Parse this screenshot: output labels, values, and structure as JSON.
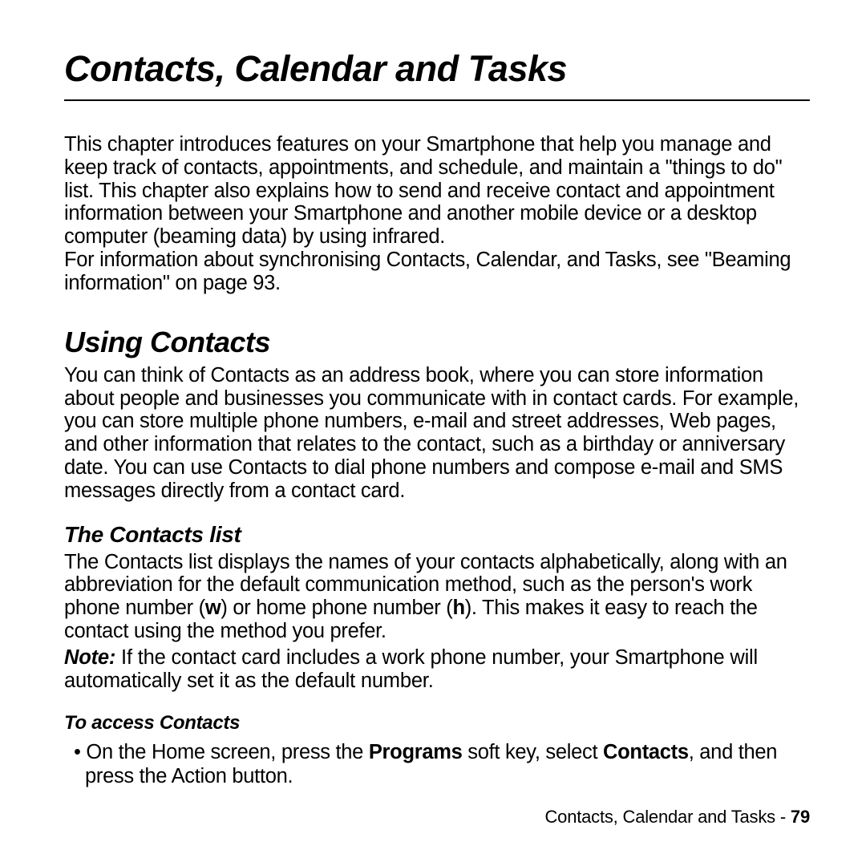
{
  "chapter_title": "Contacts, Calendar and Tasks",
  "intro_para": "This chapter introduces features on your Smartphone that help you manage and keep track of contacts, appointments, and schedule, and maintain a \"things to do\" list. This chapter also explains how to send and receive contact and appointment information between your Smartphone and another mobile device or a desktop computer (beaming data) by using infrared.",
  "intro_para2": "For information about synchronising Contacts, Calendar, and Tasks, see \"Beaming information\" on page 93.",
  "section_title": "Using Contacts",
  "section_para": "You can think of Contacts as an address book, where you can store information about people and businesses you communicate with in contact cards. For example, you can store multiple phone numbers, e-mail and street addresses, Web pages, and other information that relates to the contact, such as a birthday or anniversary date. You can use Contacts to dial phone numbers and compose e-mail and SMS messages directly from a contact card.",
  "subsection_title": "The Contacts list",
  "contacts_list_pre": "The Contacts list displays the names of your contacts alphabetically, along with an abbreviation for the default communication method, such as the person's work phone number (",
  "abbr_w": "w",
  "contacts_list_mid": ") or home phone number (",
  "abbr_h": "h",
  "contacts_list_post": "). This makes it easy to reach the contact using the method you prefer.",
  "note_label": "Note:",
  "note_text": " If the contact card includes a work phone number, your Smartphone will automatically set it as the default number.",
  "subsubsection_title": "To access Contacts",
  "bullet_pre": "On the Home screen, press the ",
  "bullet_programs": "Programs",
  "bullet_mid": " soft key, select ",
  "bullet_contacts": "Contacts",
  "bullet_post": ", and then press the Action button.",
  "footer_text": "Contacts, Calendar and Tasks - ",
  "footer_page": "79"
}
